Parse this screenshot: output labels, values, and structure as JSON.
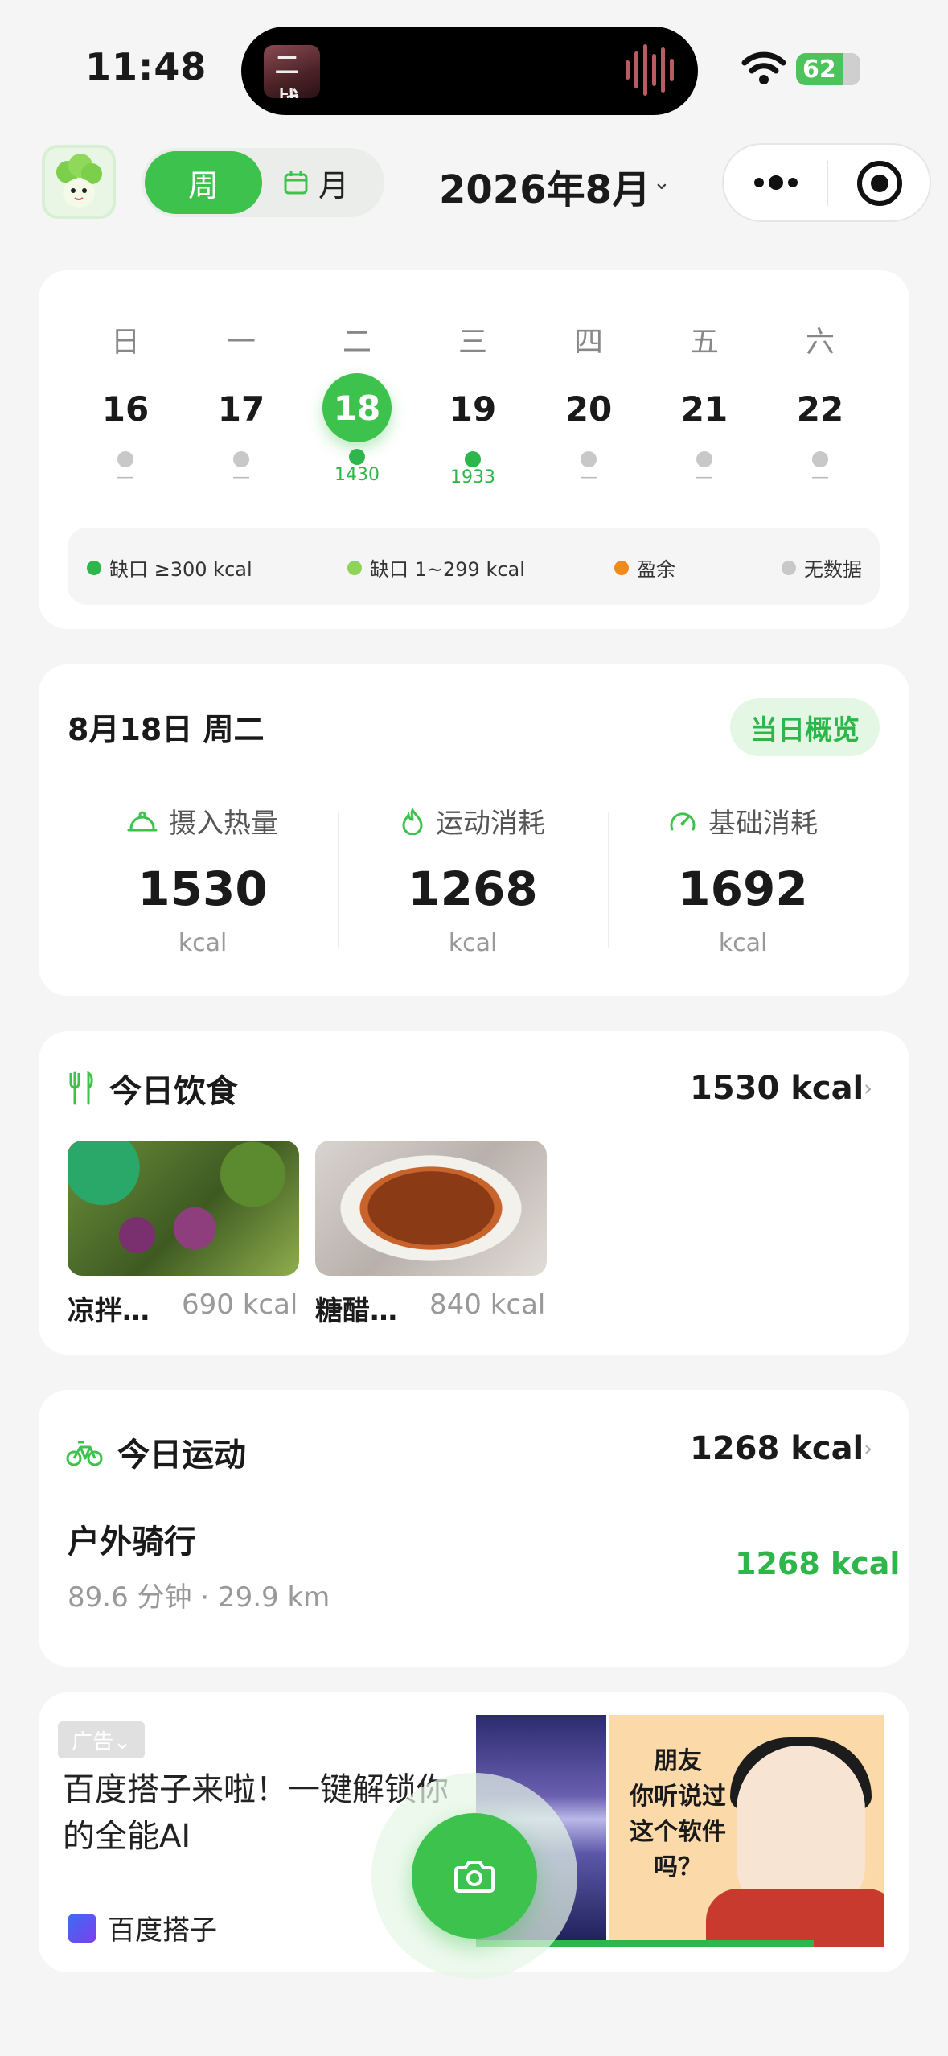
{
  "status_bar": {
    "time": "11:48",
    "island_thumb_text": "二战",
    "battery": "62"
  },
  "header": {
    "seg_week": "周",
    "seg_month": "月",
    "month_title": "2026年8月",
    "chevron": "⌄"
  },
  "calendar": {
    "weekdays": [
      "日",
      "一",
      "二",
      "三",
      "四",
      "五",
      "六"
    ],
    "days": [
      {
        "num": "16",
        "value": "—",
        "status": "none"
      },
      {
        "num": "17",
        "value": "—",
        "status": "none"
      },
      {
        "num": "18",
        "value": "1430",
        "status": "deficit-300",
        "selected": true
      },
      {
        "num": "19",
        "value": "1933",
        "status": "deficit-300"
      },
      {
        "num": "20",
        "value": "—",
        "status": "none"
      },
      {
        "num": "21",
        "value": "—",
        "status": "none"
      },
      {
        "num": "22",
        "value": "—",
        "status": "none"
      }
    ],
    "legend": [
      {
        "label": "缺口 ≥300 kcal",
        "color": "#2fb64a"
      },
      {
        "label": "缺口 1~299 kcal",
        "color": "#8fd45a"
      },
      {
        "label": "盈余",
        "color": "#f08a1c"
      },
      {
        "label": "无数据",
        "color": "#c8c8c8"
      }
    ]
  },
  "overview": {
    "date": "8月18日 周二",
    "badge": "当日概览",
    "stats": [
      {
        "label": "摄入热量",
        "value": "1530",
        "unit": "kcal",
        "icon": "cloche-icon"
      },
      {
        "label": "运动消耗",
        "value": "1268",
        "unit": "kcal",
        "icon": "flame-icon"
      },
      {
        "label": "基础消耗",
        "value": "1692",
        "unit": "kcal",
        "icon": "gauge-icon"
      }
    ]
  },
  "diet": {
    "title": "今日饮食",
    "total": "1530 kcal",
    "arrow": "›",
    "items": [
      {
        "name": "凉拌…",
        "kcal": "690 kcal"
      },
      {
        "name": "糖醋…",
        "kcal": "840 kcal"
      }
    ]
  },
  "exercise": {
    "title": "今日运动",
    "total": "1268 kcal",
    "arrow": "›",
    "item": {
      "name": "户外骑行",
      "meta": "89.6 分钟 · 29.9 km",
      "kcal": "1268 kcal"
    }
  },
  "ad": {
    "tag": "广告⌄",
    "text": "百度搭子来啦！一键解锁你的全能AI",
    "brand": "百度搭子",
    "image_text": "朋友\n你听说过\n这个软件吗？"
  },
  "colors": {
    "accent": "#3cc24d",
    "accent_text": "#2fb64a",
    "surplus": "#f08a1c"
  }
}
